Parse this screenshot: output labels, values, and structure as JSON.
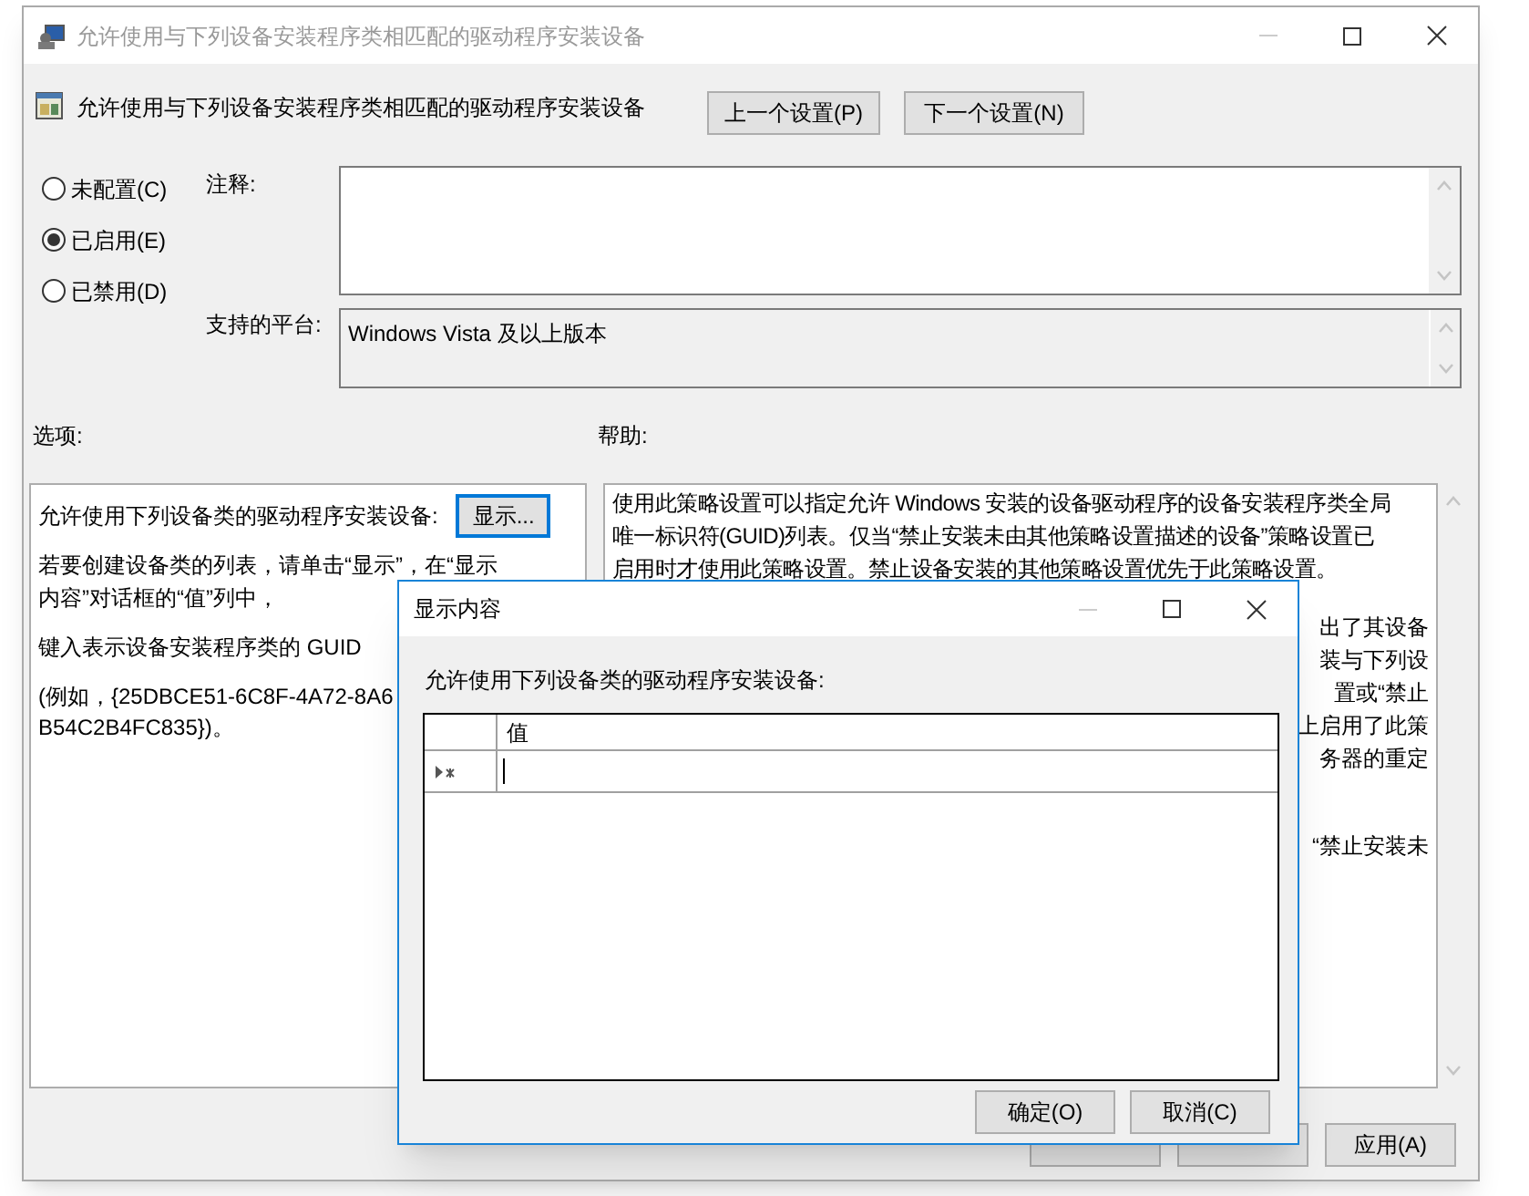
{
  "window": {
    "title": "允许使用与下列设备安装程序类相匹配的驱动程序安装设备"
  },
  "header": {
    "title": "允许使用与下列设备安装程序类相匹配的驱动程序安装设备",
    "buttons": [
      "上一个设置(P)",
      "下一个设置(N)"
    ]
  },
  "state_options": [
    {
      "label": "未配置(C)",
      "selected": false
    },
    {
      "label": "已启用(E)",
      "selected": true
    },
    {
      "label": "已禁用(D)",
      "selected": false
    }
  ],
  "comment": {
    "label": "注释:"
  },
  "platform": {
    "label": "支持的平台:",
    "value": "Windows Vista 及以上版本"
  },
  "options": {
    "label": "选项:",
    "field_label": "允许使用下列设备类的驱动程序安装设备:",
    "show_button": "显示...",
    "paragraph_lines": [
      "若要创建设备类的列表，请单击“显示”，在“显示",
      "内容”对话框的“值”列中，"
    ],
    "guid_line": "键入表示设备安装程序类的 GUID",
    "example_lines": [
      "(例如，{25DBCE51-6C8F-4A72-8A6",
      "B54C2B4FC835})。"
    ]
  },
  "help": {
    "label": "帮助:",
    "lines": [
      "使用此策略设置可以指定允许 Windows 安装的设备驱动程序的设备安装程序类全局",
      "唯一标识符(GUID)列表。仅当“禁止安装未由其他策略设置描述的设备”策略设置已",
      "启用时才使用此策略设置。禁止设备安装的其他策略设置优先于此策略设置。"
    ],
    "fragments": [
      "出了其设备",
      "装与下列设",
      "置或“禁止",
      "上启用了此策",
      "务器的重定"
    ],
    "last_fragment": "“禁止安装未"
  },
  "footer_buttons": [
    "应用(A)"
  ],
  "dialog": {
    "title": "显示内容",
    "prompt": "允许使用下列设备类的驱动程序安装设备:",
    "column": "值",
    "buttons": [
      "确定(O)",
      "取消(C)"
    ]
  }
}
